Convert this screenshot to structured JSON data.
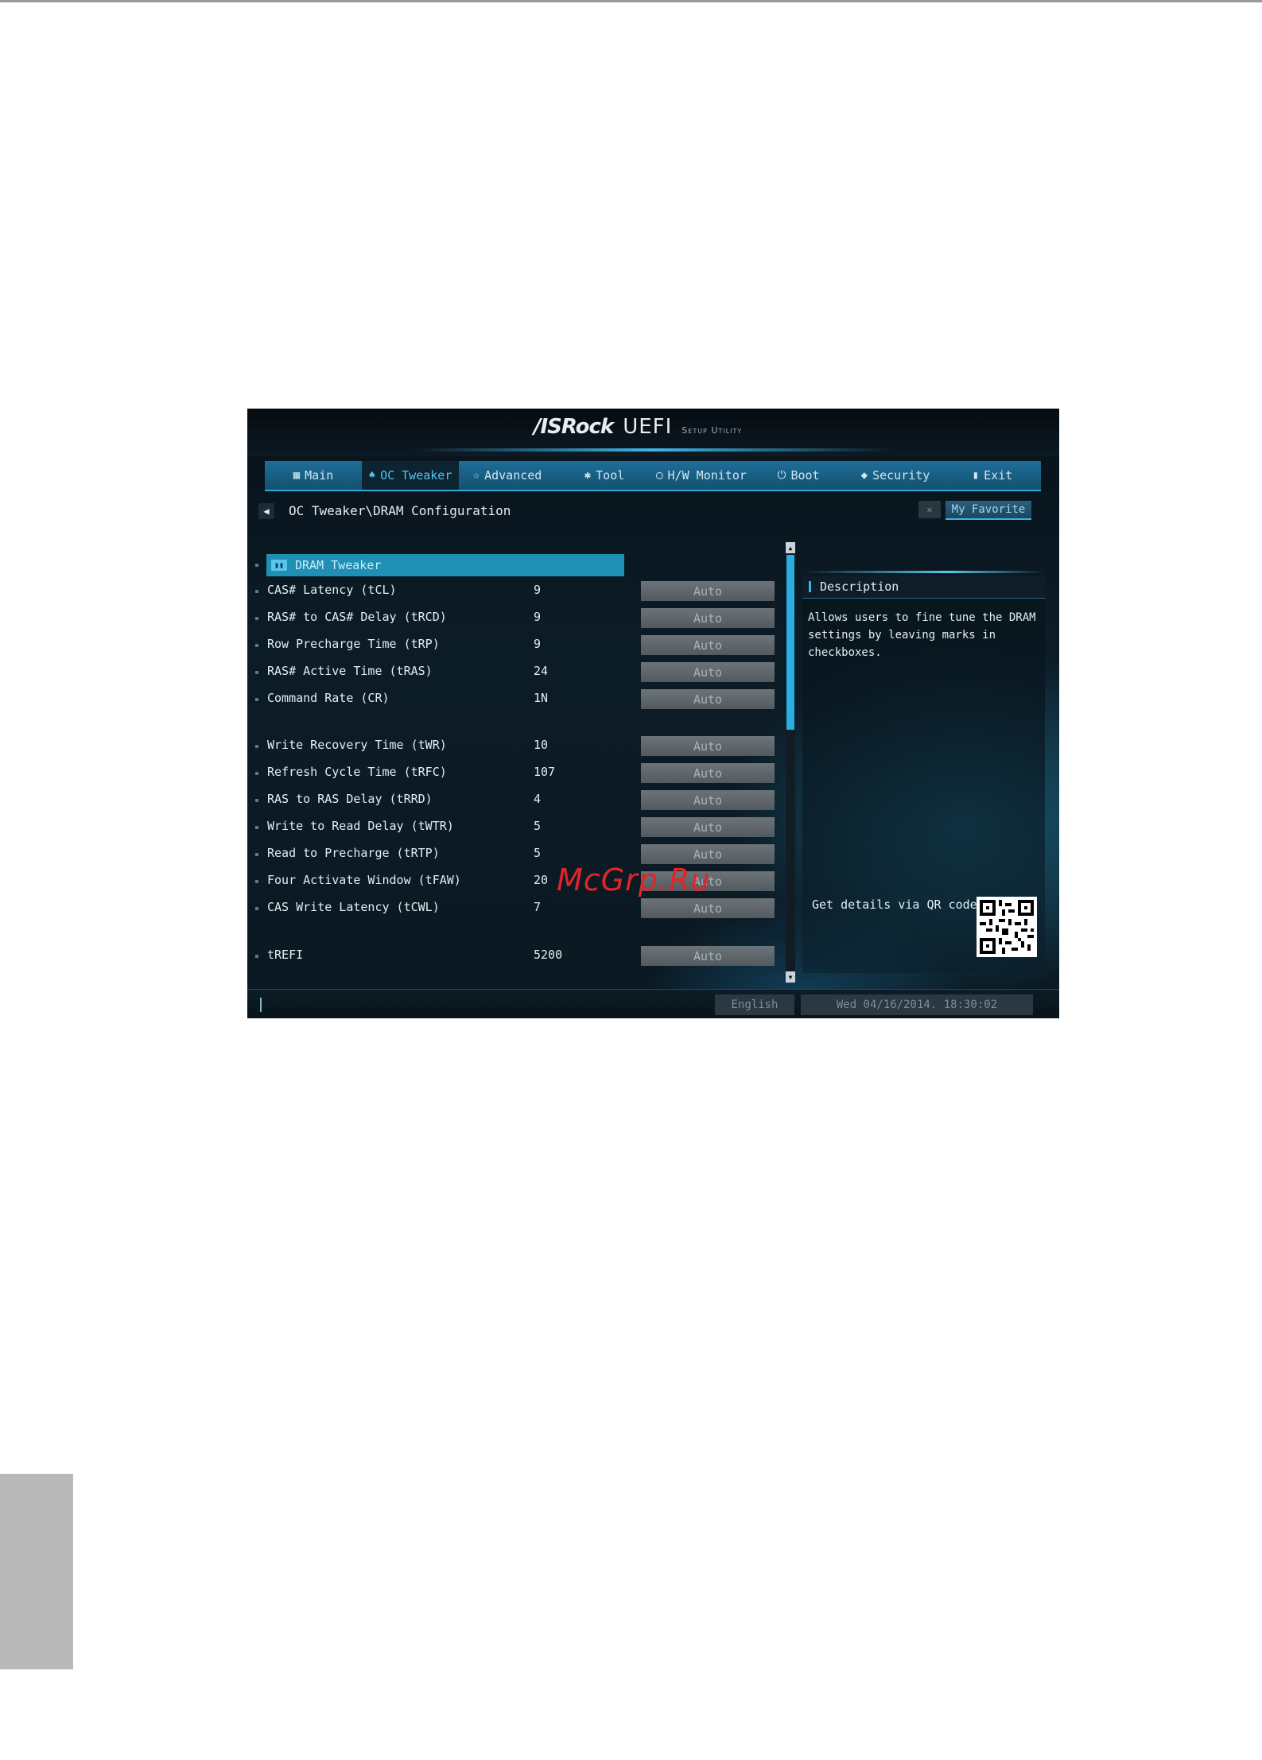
{
  "bios": {
    "logo": {
      "brand": "/ISRock",
      "product": "UEFI",
      "subtitle": "Setup Utility"
    },
    "tabs": [
      {
        "label": "Main",
        "icon": "grid-icon",
        "active": false
      },
      {
        "label": "OC Tweaker",
        "icon": "flame-icon",
        "active": true
      },
      {
        "label": "Advanced",
        "icon": "star-icon",
        "active": false
      },
      {
        "label": "Tool",
        "icon": "tool-icon",
        "active": false
      },
      {
        "label": "H/W Monitor",
        "icon": "monitor-icon",
        "active": false
      },
      {
        "label": "Boot",
        "icon": "power-icon",
        "active": false
      },
      {
        "label": "Security",
        "icon": "shield-icon",
        "active": false
      },
      {
        "label": "Exit",
        "icon": "exit-icon",
        "active": false
      }
    ],
    "breadcrumb": "OC Tweaker\\DRAM Configuration",
    "favorite": {
      "label": "My Favorite"
    },
    "section": {
      "label": "DRAM Tweaker"
    },
    "settings": [
      {
        "label": "CAS# Latency (tCL)",
        "value": "9",
        "option": "Auto"
      },
      {
        "label": "RAS# to CAS# Delay (tRCD)",
        "value": "9",
        "option": "Auto"
      },
      {
        "label": "Row Precharge Time (tRP)",
        "value": "9",
        "option": "Auto"
      },
      {
        "label": "RAS# Active Time (tRAS)",
        "value": "24",
        "option": "Auto"
      },
      {
        "label": "Command Rate (CR)",
        "value": "1N",
        "option": "Auto"
      },
      {
        "label": "Write Recovery Time (tWR)",
        "value": "10",
        "option": "Auto"
      },
      {
        "label": "Refresh Cycle Time (tRFC)",
        "value": "107",
        "option": "Auto"
      },
      {
        "label": "RAS to RAS Delay (tRRD)",
        "value": "4",
        "option": "Auto"
      },
      {
        "label": "Write to Read Delay (tWTR)",
        "value": "5",
        "option": "Auto"
      },
      {
        "label": "Read to Precharge (tRTP)",
        "value": "5",
        "option": "Auto"
      },
      {
        "label": "Four Activate Window (tFAW)",
        "value": "20",
        "option": "Auto"
      },
      {
        "label": "CAS Write Latency (tCWL)",
        "value": "7",
        "option": "Auto"
      },
      {
        "label": "tREFI",
        "value": "5200",
        "option": "Auto"
      }
    ],
    "description": {
      "title": "Description",
      "text": "Allows users to fine tune the DRAM settings by leaving marks in checkboxes.",
      "qr_label": "Get details via QR code"
    },
    "footer": {
      "language": "English",
      "datetime": "Wed 04/16/2014. 18:30:02"
    }
  },
  "watermark": "McGrp.Ru",
  "colors": {
    "accent": "#29aee0",
    "tab_bar": "#1d6e99",
    "watermark": "#e0252a"
  }
}
